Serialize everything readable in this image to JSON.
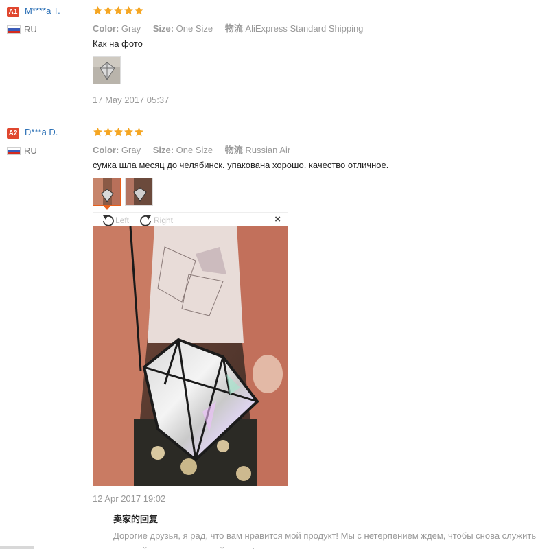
{
  "reviews": [
    {
      "badge": "A1",
      "name": "M****a T.",
      "country": "RU",
      "stars": 5,
      "color_label": "Color:",
      "color_value": "Gray",
      "size_label": "Size:",
      "size_value": "One Size",
      "shipping_label": "物流",
      "shipping_value": "AliExpress Standard Shipping",
      "comment": "Как на фото",
      "date": "17 May 2017 05:37"
    },
    {
      "badge": "A2",
      "name": "D***a D.",
      "country": "RU",
      "stars": 5,
      "color_label": "Color:",
      "color_value": "Gray",
      "size_label": "Size:",
      "size_value": "One Size",
      "shipping_label": "物流",
      "shipping_value": "Russian Air",
      "comment": "сумка шла месяц до челябинск. упакована хорошо. качество отличное.",
      "date": "12 Apr 2017 19:02"
    }
  ],
  "viewer": {
    "rotate_left": "Left",
    "rotate_right": "Right",
    "close": "×"
  },
  "seller_reply": {
    "title": "卖家的回复",
    "text_line1": "Дорогие друзья, я рад, что вам нравится мой продукт! Мы с нетерпением ждем, чтобы снова служить",
    "text_line2": "и вашей семье счастливой жизни!"
  },
  "colors": {
    "star": "#f5a623",
    "badge": "#e0472f",
    "username": "#2a6fb5",
    "active_thumb_border": "#e8601c"
  },
  "icons": [
    "star-icon",
    "russia-flag-icon",
    "rotate-left-icon",
    "rotate-right-icon",
    "close-icon"
  ]
}
